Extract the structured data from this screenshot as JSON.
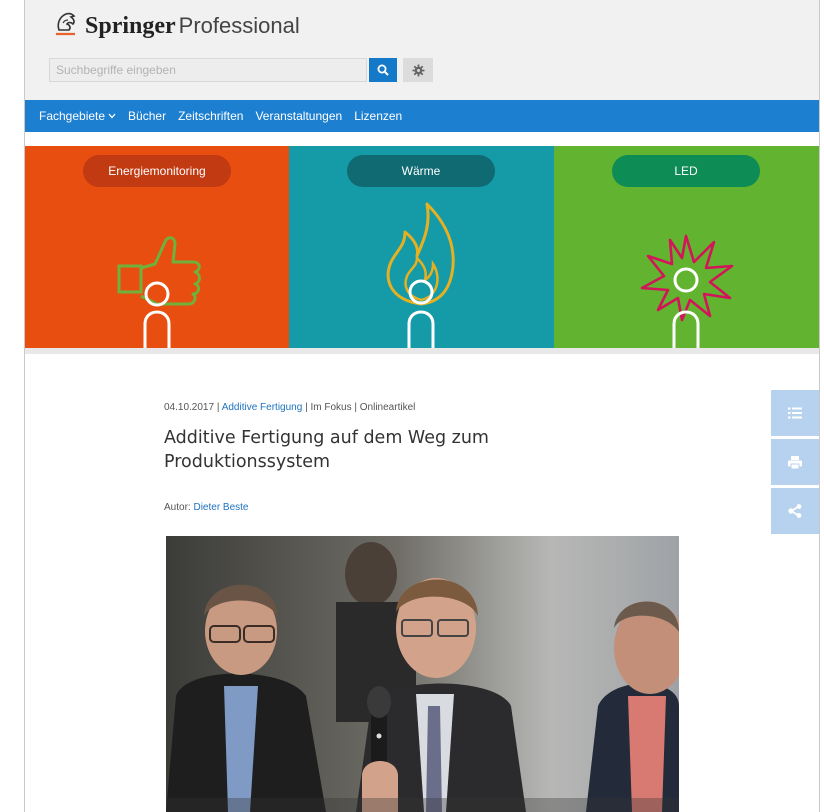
{
  "header": {
    "logo_primary": "Springer",
    "logo_secondary": "Professional",
    "search_placeholder": "Suchbegriffe eingeben",
    "icons": [
      "horse-logo-icon",
      "search-icon",
      "gear-icon"
    ]
  },
  "nav": {
    "items": [
      {
        "label": "Fachgebiete",
        "has_dropdown": true
      },
      {
        "label": "Bücher"
      },
      {
        "label": "Zeitschriften"
      },
      {
        "label": "Veranstaltungen"
      },
      {
        "label": "Lizenzen"
      }
    ]
  },
  "banner": {
    "panels": [
      {
        "label": "Energiemonitoring",
        "bg": "#e84e10",
        "pill": "#c23a12",
        "icon": "thumbs-up-bulb-icon"
      },
      {
        "label": "Wärme",
        "bg": "#159aa8",
        "pill": "#0f6a72",
        "icon": "flame-bulb-icon"
      },
      {
        "label": "LED",
        "bg": "#62b32f",
        "pill": "#0d8c55",
        "icon": "starburst-bulb-icon"
      }
    ]
  },
  "article": {
    "date": "04.10.2017",
    "category": "Additive Fertigung",
    "section": "Im Fokus",
    "type": "Onlineartikel",
    "separator": "|",
    "title": "Additive Fertigung auf dem Weg zum Produktionssystem",
    "author_label": "Autor:",
    "author_name": "Dieter Beste"
  },
  "side_tools": {
    "icons": [
      "list-icon",
      "print-icon",
      "share-icon"
    ],
    "color": "#b7d2ee"
  },
  "colors": {
    "brand_blue": "#1d7fd0",
    "link": "#1d72c0",
    "search_button": "#1479c8"
  }
}
